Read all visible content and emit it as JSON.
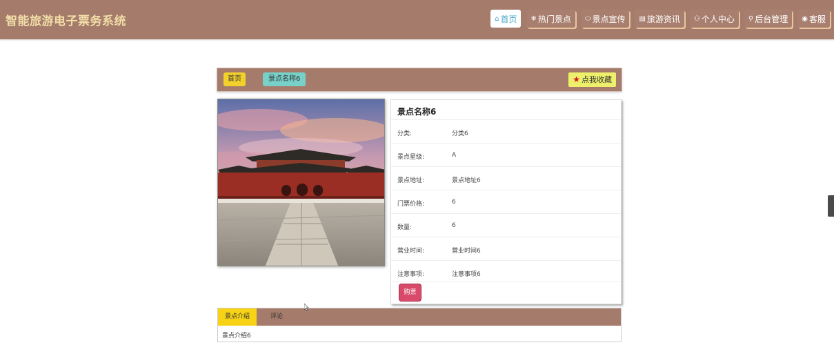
{
  "header": {
    "brand": "智能旅游电子票务系统",
    "nav": [
      {
        "icon": "⌂",
        "icon_name": "home-icon",
        "label": "首页",
        "active": true
      },
      {
        "icon": "❄",
        "icon_name": "snowflake-icon",
        "label": "热门景点"
      },
      {
        "icon": "⬭",
        "icon_name": "message-icon",
        "label": "景点宣传"
      },
      {
        "icon": "▤",
        "icon_name": "calendar-icon",
        "label": "旅游资讯"
      },
      {
        "icon": "⚇",
        "icon_name": "user-icon",
        "label": "个人中心"
      },
      {
        "icon": "⚲",
        "icon_name": "link-icon",
        "label": "后台管理"
      },
      {
        "icon": "◉",
        "icon_name": "support-icon",
        "label": "客服"
      }
    ]
  },
  "breadcrumb": {
    "home": "首页",
    "current": "景点名称6",
    "favorite": "点我收藏",
    "favorite_icon": "★"
  },
  "detail": {
    "title": "景点名称6",
    "rows": [
      {
        "key": "分类:",
        "value": "分类6"
      },
      {
        "key": "景点星级:",
        "value": "A"
      },
      {
        "key": "景点地址:",
        "value": "景点地址6"
      },
      {
        "key": "门票价格:",
        "value": "6"
      },
      {
        "key": "数量:",
        "value": "6"
      },
      {
        "key": "营业时间:",
        "value": "营业时间6"
      },
      {
        "key": "注意事项:",
        "value": "注意事项6"
      }
    ],
    "buy": "购票"
  },
  "tabs": {
    "items": [
      "景点介绍",
      "评论"
    ],
    "content": "景点介绍6"
  },
  "colors": {
    "primary": "#a57b6b",
    "brand_text": "#f1dea8",
    "home_badge": "#f2d12c",
    "current_badge": "#77d1c9",
    "favorite_bg": "#eef06b",
    "buy_button": "#d94a6a"
  }
}
